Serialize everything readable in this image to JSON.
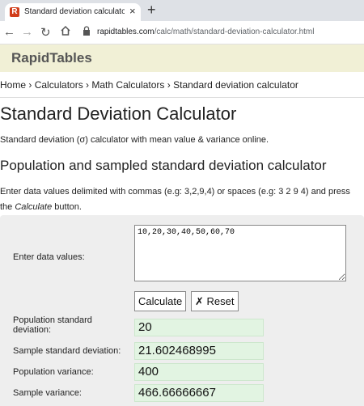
{
  "browser": {
    "tab_title": "Standard deviation calculator (σ)",
    "tab_favicon_letter": "R",
    "close": "×",
    "new_tab": "+",
    "url_host": "rapidtables.com",
    "url_path": "/calc/math/standard-deviation-calculator.html"
  },
  "site": {
    "logo": "RapidTables"
  },
  "breadcrumb": [
    "Home",
    "Calculators",
    "Math Calculators",
    "Standard deviation calculator"
  ],
  "breadcrumb_sep": " › ",
  "page": {
    "title": "Standard Deviation Calculator",
    "intro": "Standard deviation (σ) calculator with mean value & variance online.",
    "section_title": "Population and sampled standard deviation calculator",
    "instr_before": "Enter data values delimited with commas (e.g: 3,2,9,4) or spaces (e.g: 3 2 9 4) and press the ",
    "instr_em": "Calculate",
    "instr_after": " button."
  },
  "form": {
    "data_label": "Enter data values:",
    "data_value": "10,20,30,40,50,60,70",
    "calculate_label": "Calculate",
    "reset_label": "Reset",
    "reset_icon": "✗",
    "results": [
      {
        "label": "Population standard deviation:",
        "value": "20"
      },
      {
        "label": "Sample standard deviation:",
        "value": "21.602468995"
      },
      {
        "label": "Population variance:",
        "value": "400"
      },
      {
        "label": "Sample variance:",
        "value": "466.66666667"
      }
    ]
  }
}
